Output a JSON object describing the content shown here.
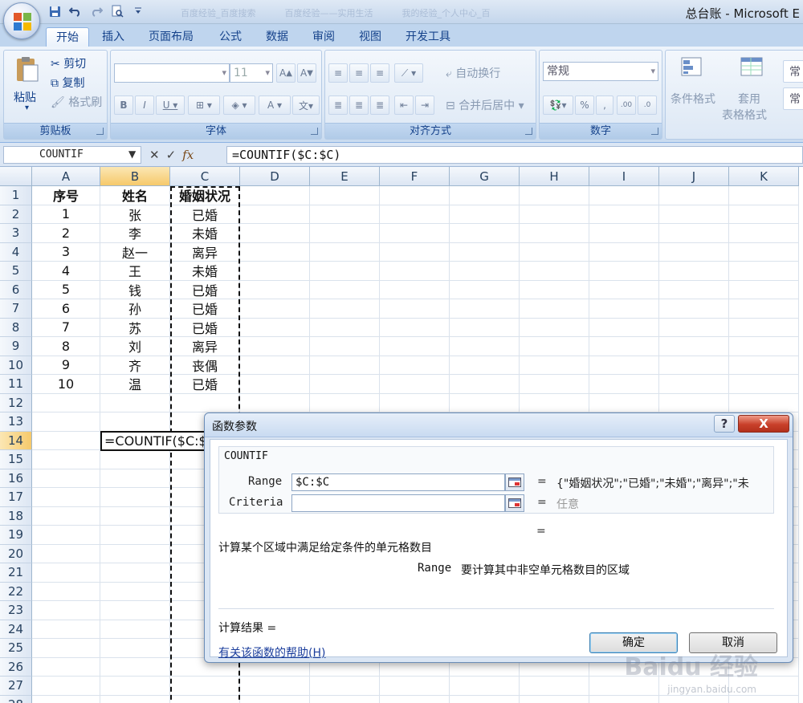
{
  "window": {
    "title": "总台账 - Microsoft E"
  },
  "background_tabs": [
    "百度经验_百度搜索",
    "百度经验——实用生活",
    "我的经验_个人中心_百"
  ],
  "ribbon": {
    "tabs": [
      "开始",
      "插入",
      "页面布局",
      "公式",
      "数据",
      "审阅",
      "视图",
      "开发工具"
    ],
    "active_tab": "开始",
    "clipboard": {
      "label": "剪贴板",
      "paste": "粘贴",
      "cut": "剪切",
      "copy": "复制",
      "format_painter": "格式刷"
    },
    "font": {
      "label": "字体",
      "size": "11"
    },
    "alignment": {
      "label": "对齐方式",
      "wrap_text": "自动换行",
      "merge_center": "合并后居中"
    },
    "number": {
      "label": "数字",
      "format": "常规"
    },
    "styles": {
      "conditional_format": "条件格式",
      "table_format_1": "套用",
      "table_format_2": "表格格式",
      "cell_style_1": "常",
      "cell_style_2": "常"
    }
  },
  "formula_bar": {
    "name_box": "COUNTIF",
    "formula": "=COUNTIF($C:$C)"
  },
  "sheet": {
    "columns": [
      "A",
      "B",
      "C",
      "D",
      "E",
      "F",
      "G",
      "H",
      "I",
      "J",
      "K"
    ],
    "rows": [
      "1",
      "2",
      "3",
      "4",
      "5",
      "6",
      "7",
      "8",
      "9",
      "10",
      "11",
      "12",
      "13",
      "14",
      "15",
      "16",
      "17",
      "18",
      "19",
      "20",
      "21",
      "22",
      "23",
      "24",
      "25",
      "26",
      "27",
      "28"
    ],
    "headers": [
      "序号",
      "姓名",
      "婚姻状况"
    ],
    "data": [
      [
        "1",
        "张",
        "已婚"
      ],
      [
        "2",
        "李",
        "未婚"
      ],
      [
        "3",
        "赵一",
        "离异"
      ],
      [
        "4",
        "王",
        "未婚"
      ],
      [
        "5",
        "钱",
        "已婚"
      ],
      [
        "6",
        "孙",
        "已婚"
      ],
      [
        "7",
        "苏",
        "已婚"
      ],
      [
        "8",
        "刘",
        "离异"
      ],
      [
        "9",
        "齐",
        "丧偶"
      ],
      [
        "10",
        "温",
        "已婚"
      ]
    ],
    "editing_cell_text": "=COUNTIF($C:$C)"
  },
  "dialog": {
    "title": "函数参数",
    "help_button": "?",
    "close_button": "X",
    "function_name": "COUNTIF",
    "range_label": "Range",
    "range_value": "$C:$C",
    "range_result": "{\"婚姻状况\";\"已婚\";\"未婚\";\"离异\";\"未",
    "criteria_label": "Criteria",
    "criteria_value": "",
    "criteria_result": "任意",
    "equals": "=",
    "description": "计算某个区域中满足给定条件的单元格数目",
    "arg_name": "Range",
    "arg_desc": "要计算其中非空单元格数目的区域",
    "result_label": "计算结果 =",
    "help_link": "有关该函数的帮助(H)",
    "ok_button": "确定",
    "cancel_button": "取消"
  },
  "watermark": {
    "main": "Baidu 经验",
    "sub": "jingyan.baidu.com"
  }
}
